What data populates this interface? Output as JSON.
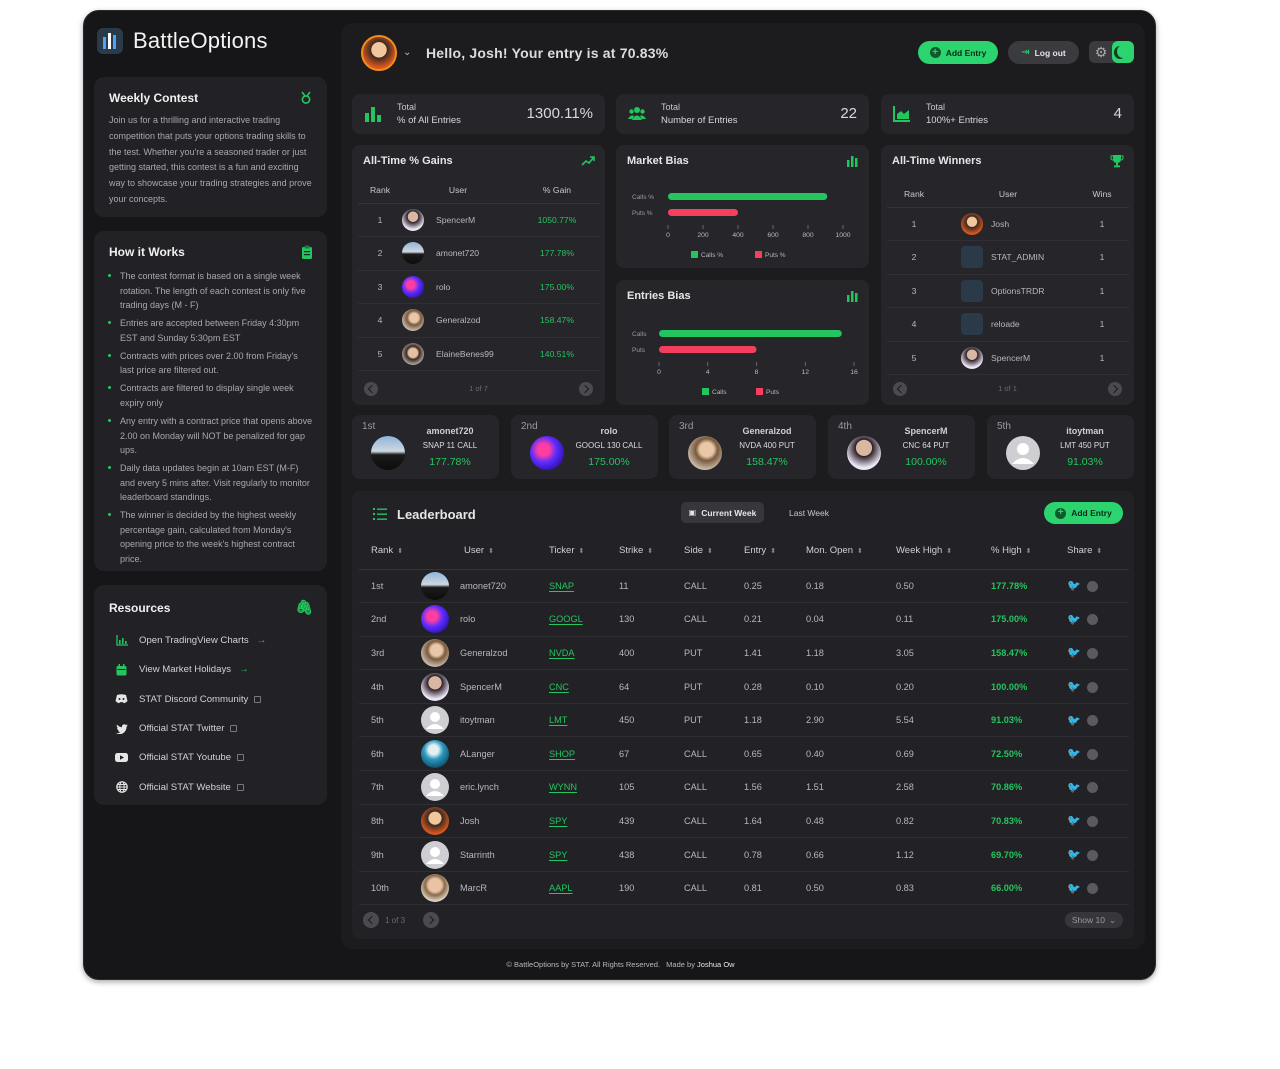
{
  "brand": {
    "name": "BattleOptions"
  },
  "sidebar": {
    "weekly": {
      "title": "Weekly Contest",
      "text": "Join us for a thrilling and interactive trading competition that puts your options trading skills to the test. Whether you're a seasoned trader or just getting started, this contest is a fun and exciting way to showcase your trading strategies and prove your concepts."
    },
    "how": {
      "title": "How it Works",
      "items": [
        "The contest format is based on a single week rotation. The length of each contest is only five trading days (M - F)",
        "Entries are accepted between Friday 4:30pm EST and Sunday 5:30pm EST",
        "Contracts with prices over 2.00 from Friday's last price are filtered out.",
        "Contracts are filtered to display single week expiry only",
        "Any entry with a contract price that opens above 2.00 on Monday will NOT be penalized for gap ups.",
        "Daily data updates begin at 10am EST (M-F) and every 5 mins after. Visit regularly to monitor leaderboard standings.",
        "The winner is decided by the highest weekly percentage gain, calculated from Monday's opening price to the week's highest contract price."
      ]
    },
    "resources": {
      "title": "Resources",
      "items": [
        {
          "label": "Open TradingView Charts",
          "icon": "chart-icon"
        },
        {
          "label": "View Market Holidays",
          "icon": "calendar-icon"
        },
        {
          "label": "STAT Discord Community",
          "icon": "discord-icon"
        },
        {
          "label": "Official STAT Twitter",
          "icon": "twitter-icon"
        },
        {
          "label": "Official STAT Youtube",
          "icon": "youtube-icon"
        },
        {
          "label": "Official STAT Website",
          "icon": "globe-icon"
        }
      ]
    }
  },
  "header": {
    "greeting": "Hello, Josh! Your entry is at 70.83%",
    "add_entry": "Add Entry",
    "logout": "Log out"
  },
  "stats": [
    {
      "line1": "Total",
      "line2": "% of All Entries",
      "value": "1300.11%"
    },
    {
      "line1": "Total",
      "line2": "Number of Entries",
      "value": "22"
    },
    {
      "line1": "Total",
      "line2": "100%+ Entries",
      "value": "4"
    }
  ],
  "gains": {
    "title": "All-Time % Gains",
    "headers": [
      "Rank",
      "User",
      "% Gain"
    ],
    "rows": [
      {
        "rank": "1",
        "user": "SpencerM",
        "gain": "1050.77%"
      },
      {
        "rank": "2",
        "user": "amonet720",
        "gain": "177.78%"
      },
      {
        "rank": "3",
        "user": "rolo",
        "gain": "175.00%"
      },
      {
        "rank": "4",
        "user": "Generalzod",
        "gain": "158.47%"
      },
      {
        "rank": "5",
        "user": "ElaineBenes99",
        "gain": "140.51%"
      }
    ],
    "page": "1 of 7"
  },
  "market_bias": {
    "title": "Market Bias",
    "labels": [
      "Calls %",
      "Puts %"
    ],
    "legend": [
      "Calls %",
      "Puts %"
    ],
    "ticks": [
      "0",
      "200",
      "400",
      "600",
      "800",
      "1000"
    ]
  },
  "entries_bias": {
    "title": "Entries Bias",
    "labels": [
      "Calls",
      "Puts"
    ],
    "legend": [
      "Calls",
      "Puts"
    ],
    "ticks": [
      "0",
      "4",
      "8",
      "12",
      "16"
    ]
  },
  "chart_data": [
    {
      "type": "bar",
      "title": "Market Bias",
      "categories": [
        "Calls %",
        "Puts %"
      ],
      "values": [
        910,
        400
      ],
      "xlim": [
        0,
        1000
      ],
      "colors": [
        "#22c55e",
        "#f43f5e"
      ]
    },
    {
      "type": "bar",
      "title": "Entries Bias",
      "categories": [
        "Calls",
        "Puts"
      ],
      "values": [
        15,
        8
      ],
      "xlim": [
        0,
        16
      ],
      "colors": [
        "#22c55e",
        "#f43f5e"
      ]
    }
  ],
  "winners": {
    "title": "All-Time Winners",
    "headers": [
      "Rank",
      "User",
      "Wins"
    ],
    "rows": [
      {
        "rank": "1",
        "user": "Josh",
        "wins": "1"
      },
      {
        "rank": "2",
        "user": "STAT_ADMIN",
        "wins": "1"
      },
      {
        "rank": "3",
        "user": "OptionsTRDR",
        "wins": "1"
      },
      {
        "rank": "4",
        "user": "reloade",
        "wins": "1"
      },
      {
        "rank": "5",
        "user": "SpencerM",
        "wins": "1"
      }
    ],
    "page": "1 of 1"
  },
  "top5": [
    {
      "place": "1st",
      "user": "amonet720",
      "contract": "SNAP 11 CALL",
      "gain": "177.78%"
    },
    {
      "place": "2nd",
      "user": "rolo",
      "contract": "GOOGL 130 CALL",
      "gain": "175.00%"
    },
    {
      "place": "3rd",
      "user": "Generalzod",
      "contract": "NVDA 400 PUT",
      "gain": "158.47%"
    },
    {
      "place": "4th",
      "user": "SpencerM",
      "contract": "CNC 64 PUT",
      "gain": "100.00%"
    },
    {
      "place": "5th",
      "user": "itoytman",
      "contract": "LMT 450 PUT",
      "gain": "91.03%"
    }
  ],
  "leaderboard": {
    "title": "Leaderboard",
    "tab_current": "Current Week",
    "tab_last": "Last Week",
    "add_entry": "Add Entry",
    "headers": [
      "Rank",
      "User",
      "Ticker",
      "Strike",
      "Side",
      "Entry",
      "Mon. Open",
      "Week High",
      "% High",
      "Share"
    ],
    "rows": [
      {
        "rank": "1st",
        "user": "amonet720",
        "ticker": "SNAP",
        "strike": "11",
        "side": "CALL",
        "entry": "0.25",
        "open": "0.18",
        "high": "0.50",
        "pct": "177.78%"
      },
      {
        "rank": "2nd",
        "user": "rolo",
        "ticker": "GOOGL",
        "strike": "130",
        "side": "CALL",
        "entry": "0.21",
        "open": "0.04",
        "high": "0.11",
        "pct": "175.00%"
      },
      {
        "rank": "3rd",
        "user": "Generalzod",
        "ticker": "NVDA",
        "strike": "400",
        "side": "PUT",
        "entry": "1.41",
        "open": "1.18",
        "high": "3.05",
        "pct": "158.47%"
      },
      {
        "rank": "4th",
        "user": "SpencerM",
        "ticker": "CNC",
        "strike": "64",
        "side": "PUT",
        "entry": "0.28",
        "open": "0.10",
        "high": "0.20",
        "pct": "100.00%"
      },
      {
        "rank": "5th",
        "user": "itoytman",
        "ticker": "LMT",
        "strike": "450",
        "side": "PUT",
        "entry": "1.18",
        "open": "2.90",
        "high": "5.54",
        "pct": "91.03%"
      },
      {
        "rank": "6th",
        "user": "ALanger",
        "ticker": "SHOP",
        "strike": "67",
        "side": "CALL",
        "entry": "0.65",
        "open": "0.40",
        "high": "0.69",
        "pct": "72.50%"
      },
      {
        "rank": "7th",
        "user": "eric.lynch",
        "ticker": "WYNN",
        "strike": "105",
        "side": "CALL",
        "entry": "1.56",
        "open": "1.51",
        "high": "2.58",
        "pct": "70.86%"
      },
      {
        "rank": "8th",
        "user": "Josh",
        "ticker": "SPY",
        "strike": "439",
        "side": "CALL",
        "entry": "1.64",
        "open": "0.48",
        "high": "0.82",
        "pct": "70.83%"
      },
      {
        "rank": "9th",
        "user": "Starrinth",
        "ticker": "SPY",
        "strike": "438",
        "side": "CALL",
        "entry": "0.78",
        "open": "0.66",
        "high": "1.12",
        "pct": "69.70%"
      },
      {
        "rank": "10th",
        "user": "MarcR",
        "ticker": "AAPL",
        "strike": "190",
        "side": "CALL",
        "entry": "0.81",
        "open": "0.50",
        "high": "0.83",
        "pct": "66.00%"
      }
    ],
    "page": "1 of 3",
    "show": "Show 10"
  },
  "footer": {
    "text": "© BattleOptions by STAT. All Rights Reserved.",
    "made_prefix": "Made by",
    "made_by": "Joshua Ow"
  }
}
